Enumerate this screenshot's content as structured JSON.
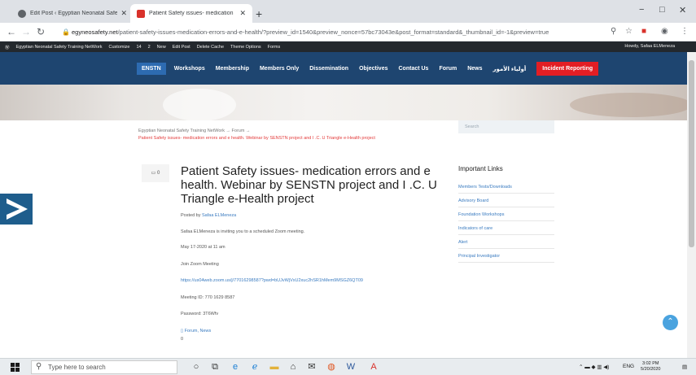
{
  "browser": {
    "tabs": [
      {
        "title": "Edit Post ‹ Egyptian Neonatal Safe"
      },
      {
        "title": "Patient Safety issues- medication"
      }
    ],
    "new_tab": "+",
    "window_controls": {
      "minimize": "−",
      "maximize": "□",
      "close": "✕"
    },
    "url_host": "egyneosafety.net",
    "url_path": "/patient-safety-issues-medication-errors-and-e-health/?preview_id=1540&preview_nonce=57bc73043e&post_format=standard&_thumbnail_id=-1&preview=true"
  },
  "wp_admin_bar": {
    "site": "Egyptian Neonatal Safety Training NetWork",
    "items": [
      "Customize",
      "14",
      "2",
      "New",
      "Edit Post",
      "Delete Cache",
      "Theme Options",
      "Forms"
    ],
    "howdy": "Howdy, Safaa ELMeneza"
  },
  "site_nav": {
    "items": [
      "ENSTN",
      "Workshops",
      "Membership",
      "Members Only",
      "Dissemination",
      "Objectives",
      "Contact Us",
      "Forum",
      "News",
      "أولياء الأمور",
      "Incident Reporting"
    ]
  },
  "breadcrumb": {
    "line1": "Egyptian Neonatal Safety Training NetWork  →  Forum  →",
    "line2": "Patient Safety issues- medication errors and e health. Webinar by SENSTN project and I .C. U Triangle e-Health project"
  },
  "search": {
    "placeholder": "Search"
  },
  "post": {
    "comments": "0",
    "title": "Patient Safety issues- medication errors and e health. Webinar by SENSTN project and I .C. U Triangle e-Health project",
    "posted_by_label": "Posted by",
    "author": "Safaa ELMeneza",
    "line1": "Safaa ELMeneza is inviting you to a scheduled Zoom meeting.",
    "line2": "May 17-2020 at 11 am",
    "line3": "Join Zoom Meeting",
    "zoom_link": "https://us04web.zoom.us/j/77016298587?pwd=bUJvWjVxU2xuc2hSR1hMem9MSGZ6QT09",
    "meeting_id": "Meeting ID: 770 1629 8587",
    "password": "Password: 3T6Wfv",
    "categories": "Forum, News",
    "tail": "0"
  },
  "sidebar": {
    "heading": "Important Links",
    "links": [
      "Members Tests/Downloads",
      "Advisory Board",
      "Foundation Workshops",
      "Indicators of care",
      "Alert",
      "Principal Investigator"
    ]
  },
  "taskbar": {
    "search_placeholder": "Type here to search",
    "language": "ENG",
    "time": "3:02 PM",
    "date": "5/20/2020"
  },
  "colors": {
    "nav_bg": "#1e4570",
    "brand_bg": "#2d6bb1",
    "incident_bg": "#e31e24",
    "link": "#3a7bc0",
    "breadcrumb_red": "#e33b3b"
  }
}
